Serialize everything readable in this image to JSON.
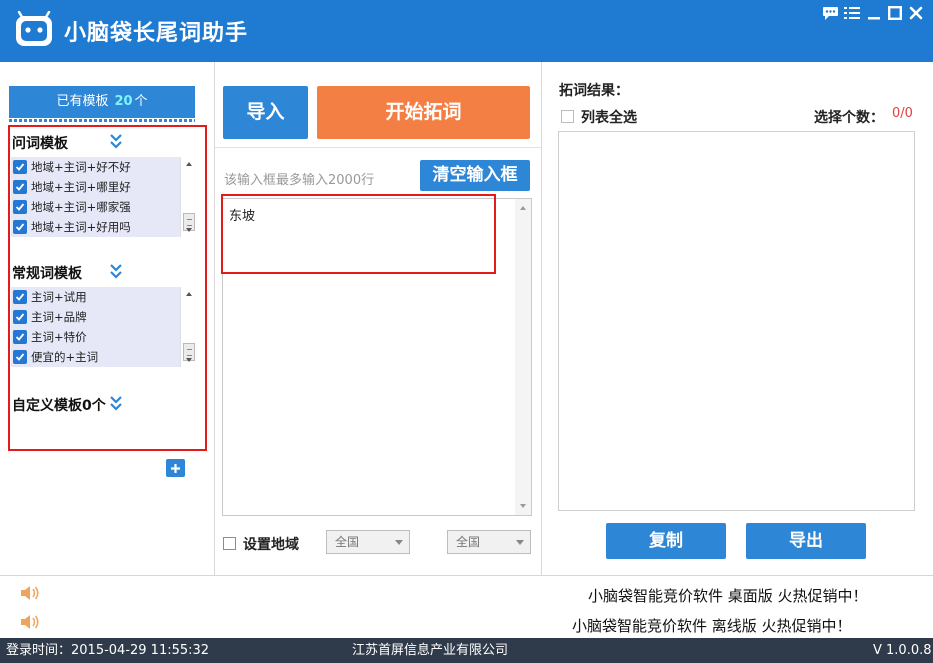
{
  "app": {
    "title": "小脑袋长尾词助手"
  },
  "window_controls": [
    "chat-icon",
    "menu-icon",
    "minimize-icon",
    "maximize-icon",
    "close-icon"
  ],
  "left": {
    "header_prefix": "已有模板",
    "header_count": "20",
    "header_suffix": "个",
    "groups": [
      {
        "title": "问词模板",
        "items": [
          "地域+主词+好不好",
          "地域+主词+哪里好",
          "地域+主词+哪家强",
          "地域+主词+好用吗"
        ]
      },
      {
        "title": "常规词模板",
        "items": [
          "主词+试用",
          "主词+品牌",
          "主词+特价",
          "便宜的+主词"
        ]
      }
    ],
    "custom_title": "自定义模板0个"
  },
  "middle": {
    "import_label": "导入",
    "start_label": "开始拓词",
    "hint": "该输入框最多输入2000行",
    "clear_label": "清空输入框",
    "input_value": "东坡",
    "region_label": "设置地域",
    "region_select_1": "全国",
    "region_select_2": "全国"
  },
  "right": {
    "result_title": "拓词结果：",
    "select_all_label": "列表全选",
    "select_count_label": "选择个数：",
    "select_count_value": "0/0",
    "copy_label": "复制",
    "export_label": "导出"
  },
  "footer": {
    "ad_1": "小脑袋智能竞价软件 桌面版 火热促销中！",
    "ad_2": "小脑袋智能竞价软件 离线版 火热促销中！",
    "login_time": "登录时间：2015-04-29 11:55:32",
    "company": "江苏首屏信息产业有限公司",
    "version": "V 1.0.0.8"
  },
  "colors": {
    "brand_blue": "#1f7ad2",
    "button_blue": "#2d86d6",
    "button_orange": "#f47f44",
    "highlight_red": "#e31b1b",
    "status_bar": "#2f3a4b"
  }
}
